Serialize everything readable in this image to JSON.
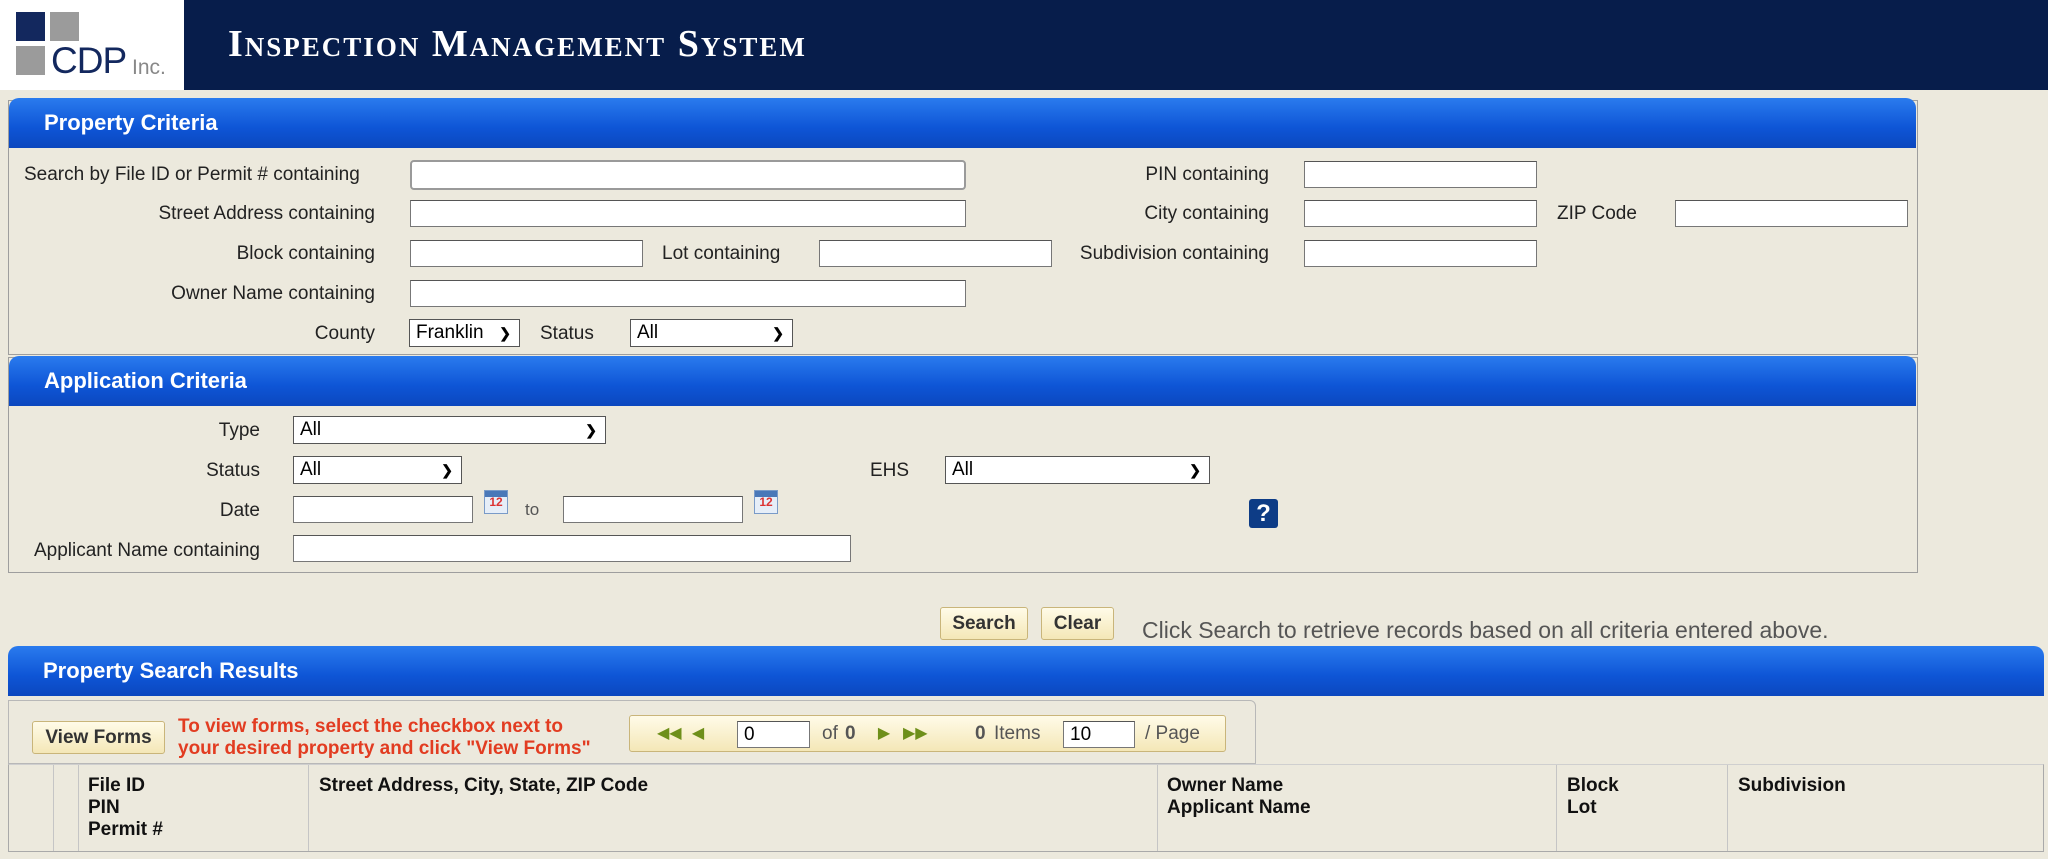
{
  "header": {
    "logo_text": "CDP",
    "logo_suffix": "Inc.",
    "title": "Inspection Management System"
  },
  "property_criteria": {
    "title": "Property Criteria",
    "file_id_label": "Search by File ID or Permit # containing",
    "file_id_value": "",
    "pin_label": "PIN containing",
    "pin_value": "",
    "street_label": "Street Address containing",
    "street_value": "",
    "city_label": "City containing",
    "city_value": "",
    "zip_label": "ZIP Code",
    "zip_value": "",
    "block_label": "Block containing",
    "block_value": "",
    "lot_label": "Lot containing",
    "lot_value": "",
    "subdivision_label": "Subdivision containing",
    "subdivision_value": "",
    "owner_label": "Owner Name containing",
    "owner_value": "",
    "county_label": "County",
    "county_value": "Franklin",
    "status_label": "Status",
    "status_value": "All"
  },
  "application_criteria": {
    "title": "Application Criteria",
    "type_label": "Type",
    "type_value": "All",
    "status_label": "Status",
    "status_value": "All",
    "ehs_label": "EHS",
    "ehs_value": "All",
    "date_label": "Date",
    "date_from": "",
    "date_to_label": "to",
    "date_to": "",
    "calendar_glyph": "12",
    "help_glyph": "?",
    "applicant_label": "Applicant Name containing",
    "applicant_value": ""
  },
  "actions": {
    "search_label": "Search",
    "clear_label": "Clear",
    "hint": "Click Search to retrieve records based on all criteria entered above."
  },
  "results": {
    "title": "Property Search Results",
    "view_forms_label": "View Forms",
    "view_forms_msg_line1": "To view forms, select the checkbox next to",
    "view_forms_msg_line2": "your desired property and click \"View Forms\"",
    "pager": {
      "page_value": "0",
      "of_label": "of",
      "total_pages": "0",
      "items_count": "0",
      "items_label": "Items",
      "page_size": "10",
      "per_page_label": "/ Page"
    },
    "columns": [
      {
        "lines": [
          "File ID",
          "PIN",
          "Permit #"
        ]
      },
      {
        "lines": [
          "Street Address, City, State, ZIP Code"
        ]
      },
      {
        "lines": [
          "Owner Name",
          "Applicant Name"
        ]
      },
      {
        "lines": [
          "Block",
          "Lot"
        ]
      },
      {
        "lines": [
          "Subdivision"
        ]
      }
    ]
  },
  "colors": {
    "header_bg": "#071d4b",
    "panel_header_blue": "#0e55d6",
    "message_red": "#e23c21",
    "button_cream": "#f4e7b7"
  }
}
